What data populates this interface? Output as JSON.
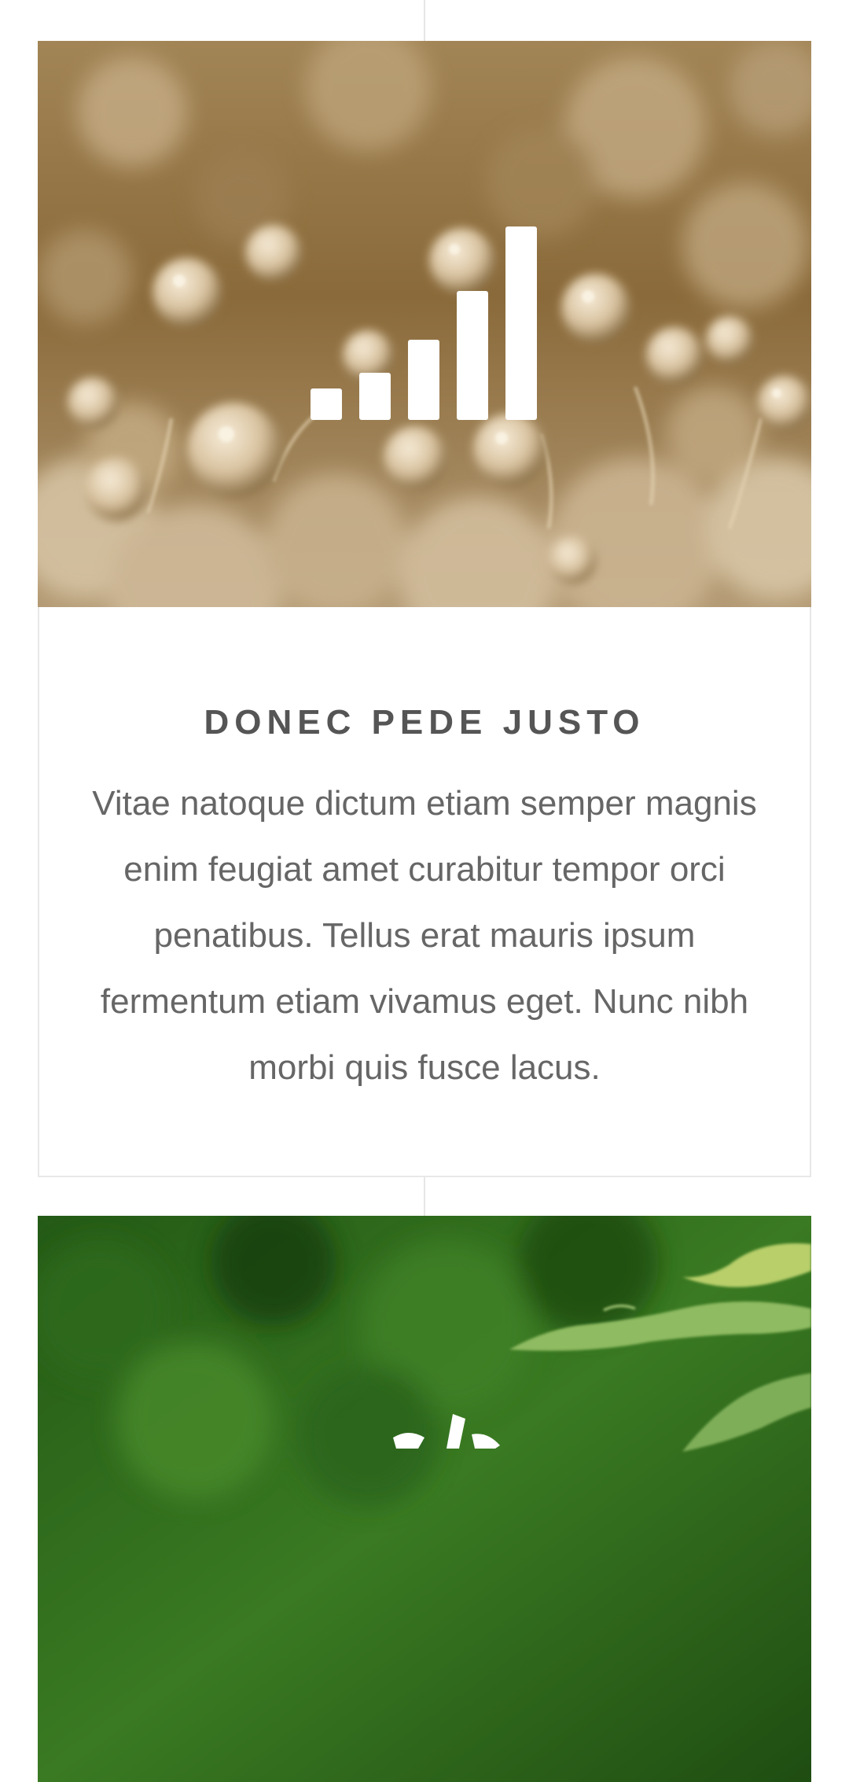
{
  "timeline": {
    "cards": [
      {
        "icon": "signal-bars-icon",
        "image_theme": "golden dew drops",
        "title": "DONEC PEDE JUSTO",
        "text": "Vitae natoque dictum etiam semper magnis enim feugiat amet curabitur tempor orci penatibus. Tellus erat mauris ipsum fermentum etiam vivamus eget. Nunc nibh morbi quis fusce lacus."
      },
      {
        "icon": "leaf-sprout-icon",
        "image_theme": "green leaves"
      }
    ]
  },
  "colors": {
    "title": "#555555",
    "body_text": "#666666",
    "border": "#e8e8e8",
    "icon": "#ffffff"
  }
}
